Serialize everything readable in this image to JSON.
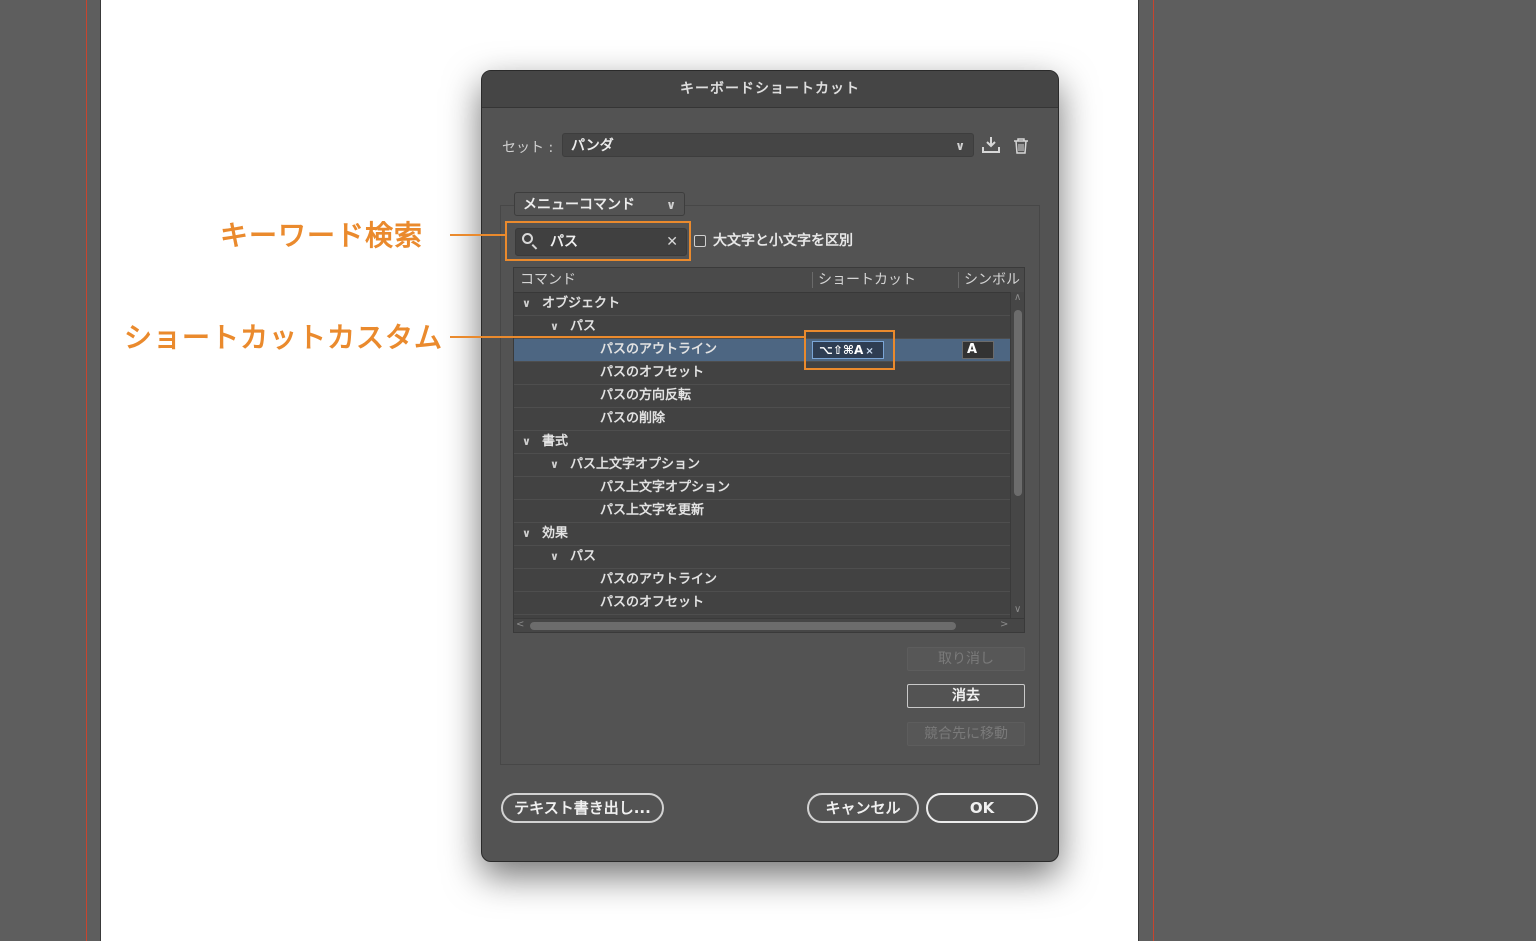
{
  "dialog": {
    "title": "キーボードショートカット",
    "set_label": "セット :",
    "set_value": "パンダ",
    "export_icon": "download-icon",
    "delete_icon": "trash-icon",
    "menu_select": "メニューコマンド",
    "search_value": "パス",
    "case_checkbox_label": "大文字と小文字を区別",
    "case_checked": false,
    "columns": [
      "コマンド",
      "ショートカット",
      "シンボル"
    ],
    "rows": [
      {
        "level": 0,
        "expanded": true,
        "label": "オブジェクト"
      },
      {
        "level": 1,
        "expanded": true,
        "label": "パス"
      },
      {
        "level": 2,
        "label": "パスのアウトライン",
        "selected": true,
        "shortcut": "⌥⇧⌘A",
        "symbol": "A"
      },
      {
        "level": 2,
        "label": "パスのオフセット"
      },
      {
        "level": 2,
        "label": "パスの方向反転"
      },
      {
        "level": 2,
        "label": "パスの削除"
      },
      {
        "level": 0,
        "expanded": true,
        "label": "書式"
      },
      {
        "level": 1,
        "expanded": true,
        "label": "パス上文字オプション"
      },
      {
        "level": 2,
        "label": "パス上文字オプション"
      },
      {
        "level": 2,
        "label": "パス上文字を更新"
      },
      {
        "level": 0,
        "expanded": true,
        "label": "効果"
      },
      {
        "level": 1,
        "expanded": true,
        "label": "パス"
      },
      {
        "level": 2,
        "label": "パスのアウトライン"
      },
      {
        "level": 2,
        "label": "パスのオフセット"
      }
    ],
    "buttons": {
      "undo": "取り消し",
      "clear": "消去",
      "goto_conflict": "競合先に移動",
      "export_text": "テキスト書き出し...",
      "cancel": "キャンセル",
      "ok": "OK"
    }
  },
  "annotations": {
    "search": "キーワード検索",
    "shortcut": "ショートカットカスタム"
  },
  "colors": {
    "annotation": "#ea8a2d",
    "dialog_bg": "#535353",
    "selected_row": "#4d6682"
  }
}
